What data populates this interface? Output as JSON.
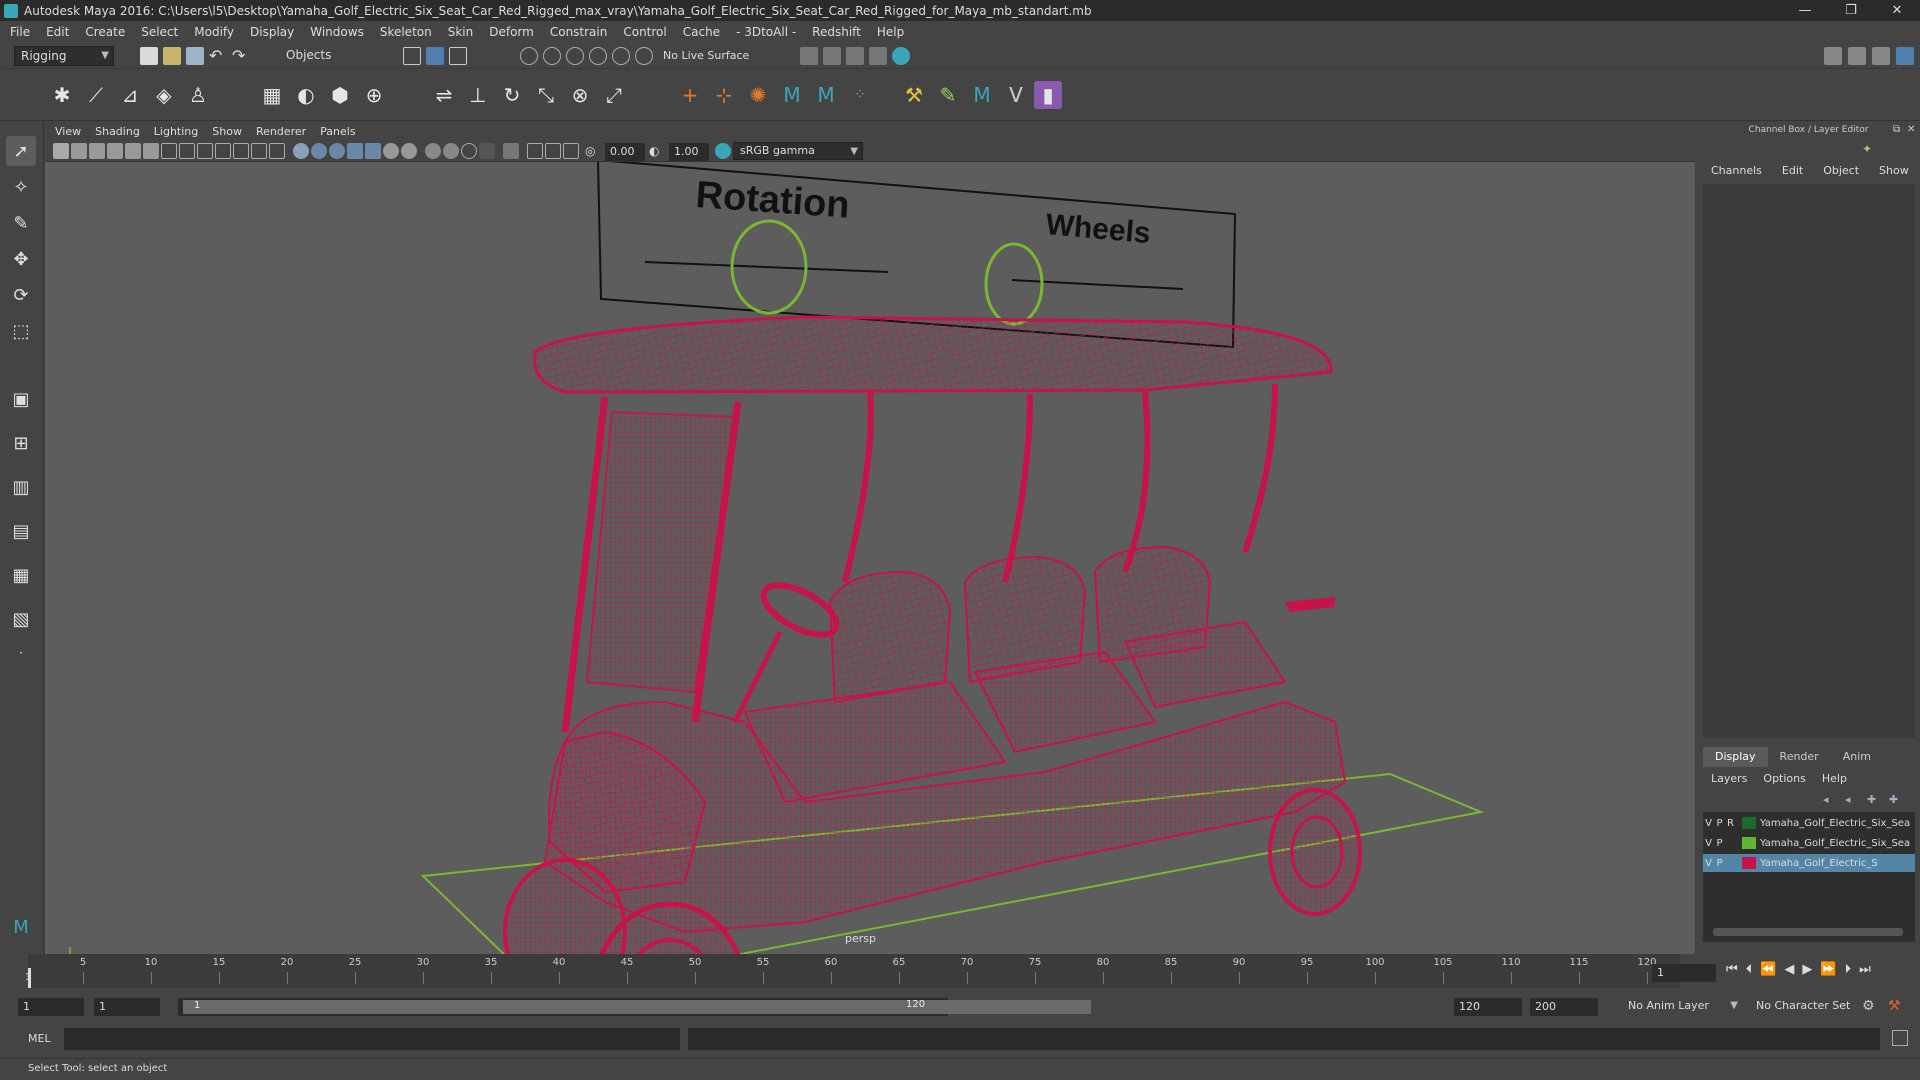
{
  "window": {
    "title": "Autodesk Maya 2016: C:\\Users\\l5\\Desktop\\Yamaha_Golf_Electric_Six_Seat_Car_Red_Rigged_max_vray\\Yamaha_Golf_Electric_Six_Seat_Car_Red_Rigged_for_Maya_mb_standart.mb",
    "minimize": "—",
    "restore": "❐",
    "close": "✕"
  },
  "menubar": [
    "File",
    "Edit",
    "Create",
    "Select",
    "Modify",
    "Display",
    "Windows",
    "Skeleton",
    "Skin",
    "Deform",
    "Constrain",
    "Control",
    "Cache",
    "- 3DtoAll -",
    "Redshift",
    "Help"
  ],
  "statusline": {
    "menuset": "Rigging",
    "selection_mode": "Objects",
    "live_surface": "No Live Surface"
  },
  "panel": {
    "menus": [
      "View",
      "Shading",
      "Lighting",
      "Show",
      "Renderer",
      "Panels"
    ],
    "exposure": "0.00",
    "gamma": "1.00",
    "color_space": "sRGB gamma",
    "camera": "persp"
  },
  "scene": {
    "control_labels": [
      "Rotation",
      "Wheels"
    ],
    "wire_color": "#c8124a",
    "control_color": "#7ab832"
  },
  "channelbox": {
    "title": "Channel Box / Layer Editor",
    "menus": [
      "Channels",
      "Edit",
      "Object",
      "Show"
    ],
    "tabs": [
      "Display",
      "Render",
      "Anim"
    ],
    "layer_menus": [
      "Layers",
      "Options",
      "Help"
    ],
    "layers": [
      {
        "v": "V",
        "p": "P",
        "r": "R",
        "name": "Yamaha_Golf_Electric_Six_Sea",
        "color": "#1d6b2a"
      },
      {
        "v": "V",
        "p": "P",
        "r": "",
        "name": "Yamaha_Golf_Electric_Six_Sea",
        "color": "#5fb632"
      },
      {
        "v": "V",
        "p": "P",
        "r": "",
        "name": "Yamaha_Golf_Electric_S",
        "color": "#c8124a"
      }
    ]
  },
  "timeslider": {
    "ticks": [
      "5",
      "10",
      "15",
      "20",
      "25",
      "30",
      "35",
      "40",
      "45",
      "50",
      "55",
      "60",
      "65",
      "70",
      "75",
      "80",
      "85",
      "90",
      "95",
      "100",
      "105",
      "110",
      "115",
      "120"
    ],
    "start_label": "1",
    "current_frame": "1"
  },
  "rangeslider": {
    "start": "1",
    "playback_start": "1",
    "range_start": "1",
    "range_end": "120",
    "playback_end": "120",
    "end": "200",
    "anim_layer": "No Anim Layer",
    "character_set": "No Character Set"
  },
  "cmdline": {
    "label": "MEL"
  },
  "helpline": {
    "text": "Select Tool: select an object"
  }
}
